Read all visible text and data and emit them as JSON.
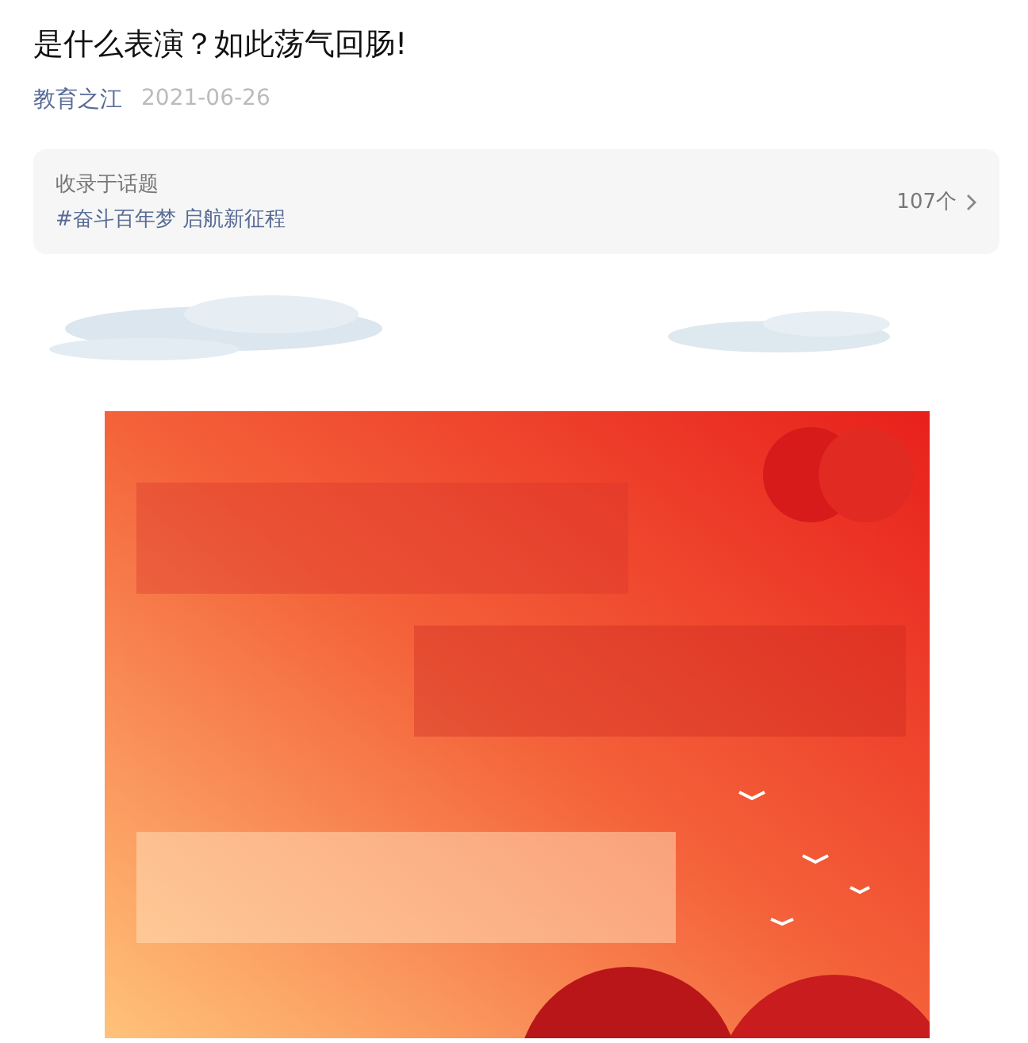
{
  "article": {
    "title": "是什么表演？如此荡气回肠!",
    "author": "教育之江",
    "date": "2021-06-26"
  },
  "topic": {
    "label": "收录于话题",
    "tag": "#奋斗百年梦 启航新征程",
    "count": "107个"
  }
}
